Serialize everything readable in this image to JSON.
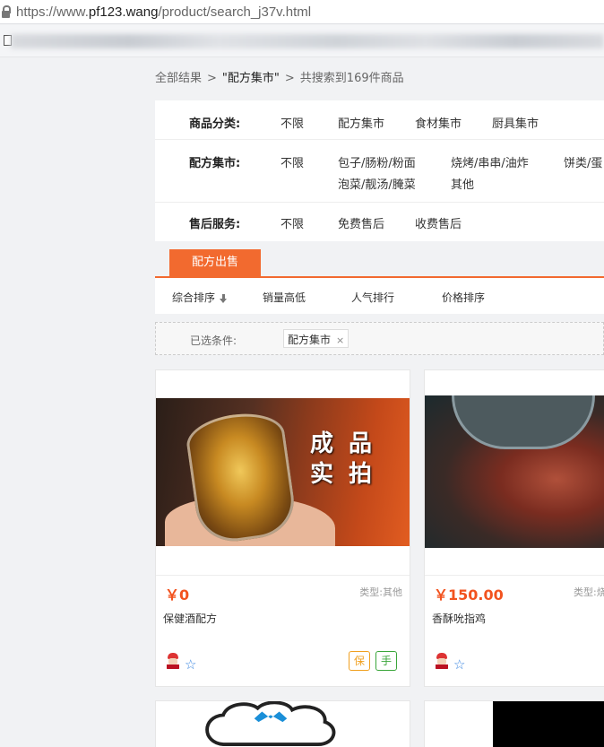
{
  "browser": {
    "url_prefix": "https://www.",
    "url_host": "pf123.wang",
    "url_path": "/product/search_j37v.html"
  },
  "breadcrumb": {
    "root": "全部结果",
    "sep": ">",
    "current": "\"配方集市\"",
    "summary": "共搜索到169件商品"
  },
  "filters": {
    "category": {
      "label": "商品分类:",
      "options": [
        "不限",
        "配方集市",
        "食材集市",
        "厨具集市"
      ]
    },
    "market": {
      "label": "配方集市:",
      "options": [
        "不限",
        "包子/肠粉/粉面",
        "烧烤/串串/油炸",
        "饼类/蛋",
        "泡菜/靓汤/腌菜",
        "其他"
      ]
    },
    "service": {
      "label": "售后服务:",
      "options": [
        "不限",
        "免费售后",
        "收费售后"
      ]
    }
  },
  "tabs": {
    "active": "配方出售"
  },
  "sort": {
    "items": [
      "综合排序",
      "销量高低",
      "人气排行",
      "价格排序"
    ]
  },
  "selected": {
    "label": "已选条件:",
    "chip": "配方集市",
    "chip_close": "×"
  },
  "products": [
    {
      "price": "￥0",
      "type": "类型:其他",
      "title": "保健酒配方",
      "image_text_1": "成 品",
      "image_text_2": "实 拍",
      "badges": [
        "保",
        "手"
      ]
    },
    {
      "price": "￥150.00",
      "type": "类型:烧",
      "title": "香酥吮指鸡"
    }
  ],
  "colors": {
    "accent": "#f26a2f",
    "price": "#f2531f",
    "badge_bao": "#f0a020",
    "badge_shou": "#3aa63a",
    "star": "#3a86e0"
  },
  "icons": [
    "lock-icon",
    "page-icon",
    "sort-arrow-down-icon",
    "close-icon",
    "avatar-icon",
    "star-icon"
  ]
}
